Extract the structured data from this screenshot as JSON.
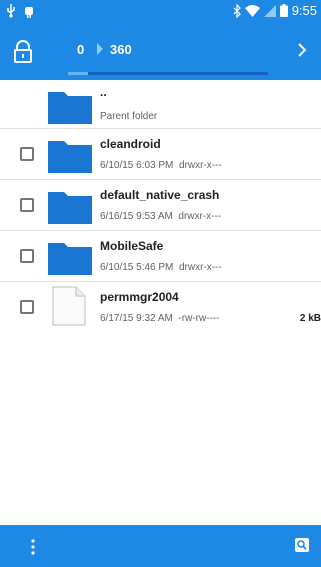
{
  "status_bar": {
    "time": "9:55"
  },
  "toolbar": {
    "crumb_root": "0",
    "crumb_current": "360",
    "progress_fraction": 0.1
  },
  "files": [
    {
      "name": "..",
      "meta": "Parent folder",
      "type": "parent"
    },
    {
      "name": "cleandroid",
      "date": "6/10/15 6:03 PM",
      "perms": "drwxr-x---",
      "type": "folder"
    },
    {
      "name": "default_native_crash",
      "date": "6/16/15 9:53 AM",
      "perms": "drwxr-x---",
      "type": "folder"
    },
    {
      "name": "MobileSafe",
      "date": "6/10/15 5:46 PM",
      "perms": "drwxr-x---",
      "type": "folder"
    },
    {
      "name": "permmgr2004",
      "date": "6/17/15 9:32 AM",
      "perms": "-rw-rw----",
      "size": "2 kB",
      "type": "file"
    }
  ],
  "colors": {
    "accent": "#1e88e5",
    "folder": "#1976d2"
  }
}
